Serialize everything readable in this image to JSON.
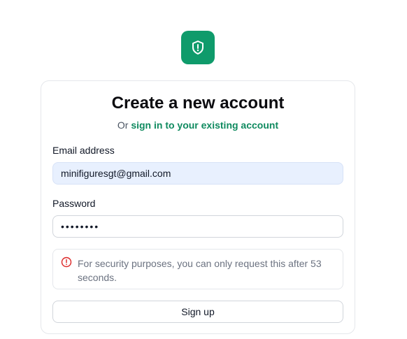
{
  "brand": {
    "logo_icon": "shield-alert-icon",
    "accent_color": "#0f9b6b"
  },
  "header": {
    "title": "Create a new account",
    "subtitle_prefix": "Or",
    "signin_link": "sign in to your existing account"
  },
  "form": {
    "email_label": "Email address",
    "email_value": "minifiguresgt@gmail.com",
    "password_label": "Password",
    "password_value": "********",
    "alert_text": "For security purposes, you can only request this after 53 seconds.",
    "alert_icon": "alert-circle-icon",
    "submit_label": "Sign up"
  }
}
